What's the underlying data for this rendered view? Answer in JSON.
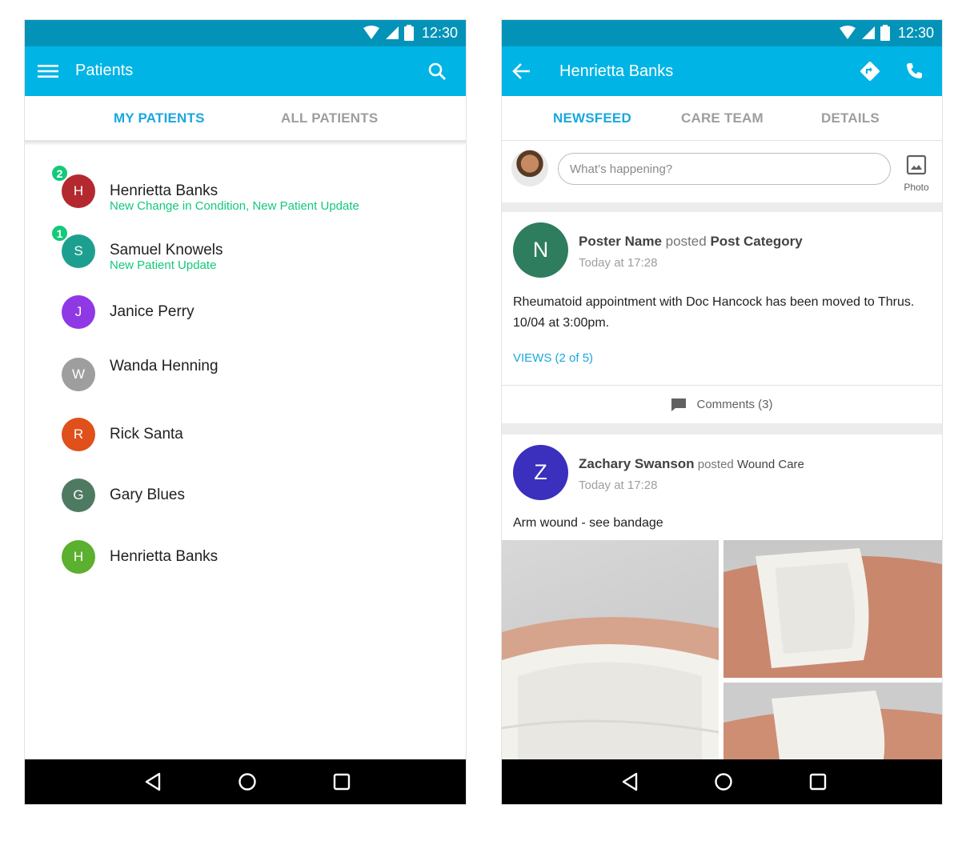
{
  "status_bar": {
    "time": "12:30"
  },
  "left": {
    "appbar": {
      "title": "Patients"
    },
    "tabs": [
      {
        "label": "MY PATIENTS",
        "active": true
      },
      {
        "label": "ALL PATIENTS",
        "active": false
      }
    ],
    "patients": [
      {
        "initial": "H",
        "name": "Henrietta Banks",
        "subtitle": "New Change in Condition, New Patient Update",
        "badge": "2",
        "color": "#b3292f"
      },
      {
        "initial": "S",
        "name": "Samuel Knowels",
        "subtitle": "New Patient Update",
        "badge": "1",
        "color": "#1d9f8f"
      },
      {
        "initial": "J",
        "name": "Janice Perry",
        "subtitle": "",
        "badge": "",
        "color": "#8f39e5"
      },
      {
        "initial": "W",
        "name": "Wanda Henning",
        "subtitle": "",
        "badge": "",
        "color": "#9e9e9e"
      },
      {
        "initial": "R",
        "name": "Rick Santa",
        "subtitle": "",
        "badge": "",
        "color": "#e0501a"
      },
      {
        "initial": "G",
        "name": "Gary Blues",
        "subtitle": "",
        "badge": "",
        "color": "#4f7a62"
      },
      {
        "initial": "H",
        "name": "Henrietta Banks",
        "subtitle": "",
        "badge": "",
        "color": "#5bb02f"
      }
    ]
  },
  "right": {
    "appbar": {
      "title": "Henrietta Banks"
    },
    "tabs": [
      {
        "label": "NEWSFEED",
        "active": true
      },
      {
        "label": "CARE TEAM",
        "active": false
      },
      {
        "label": "DETAILS",
        "active": false
      }
    ],
    "compose": {
      "placeholder": "What’s happening?",
      "photo_label": "Photo"
    },
    "posts": [
      {
        "initial": "N",
        "color": "#2e7d5e",
        "poster": "Poster Name",
        "verb": " posted ",
        "category": "Post Category",
        "time": "Today at 17:28",
        "body": "Rheumatoid appointment with Doc Hancock has been moved to Thrus. 10/04 at 3:00pm.",
        "views": "VIEWS (2 of 5)",
        "comments": "Comments (3)"
      },
      {
        "initial": "Z",
        "color": "#3b2fbd",
        "poster": "Zachary Swanson",
        "verb": " posted ",
        "category": "Wound Care",
        "time": "Today at 17:28",
        "body": "Arm wound - see bandage"
      }
    ]
  },
  "colors": {
    "status_bar": "#0493b8",
    "app_bar": "#00b4e5",
    "accent": "#1aa7dd",
    "badge_green": "#13c97a"
  },
  "icons": [
    "menu-icon",
    "search-icon",
    "back-arrow-icon",
    "directions-icon",
    "phone-icon",
    "image-icon",
    "comment-icon",
    "wifi-icon",
    "cell-signal-icon",
    "battery-icon",
    "nav-back-icon",
    "nav-home-icon",
    "nav-recents-icon"
  ]
}
